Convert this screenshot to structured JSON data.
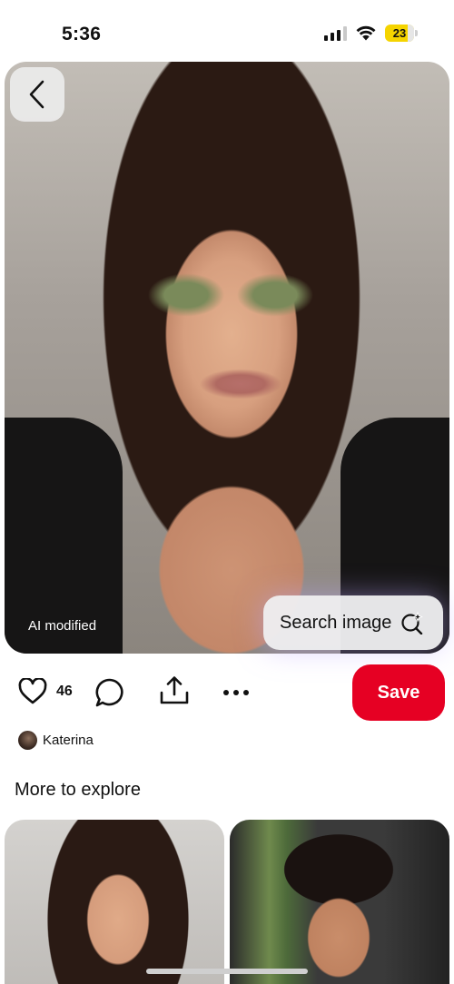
{
  "status_bar": {
    "time": "5:36",
    "battery_percent": "23",
    "battery_color": "#f5d400",
    "icons": [
      "cellular-signal-icon",
      "wifi-icon",
      "battery-icon"
    ]
  },
  "pin": {
    "ai_label": "AI modified",
    "search_image_label": "Search image",
    "like_count": "46",
    "save_label": "Save",
    "save_color": "#e60023",
    "author_name": "Katerina",
    "icons": [
      "back-chevron-icon",
      "visual-search-sparkle-icon",
      "heart-icon",
      "comment-icon",
      "share-icon",
      "more-icon"
    ]
  },
  "explore": {
    "title": "More to explore",
    "cards": [
      {
        "subject": "woman portrait"
      },
      {
        "subject": "man portrait in car"
      }
    ]
  }
}
